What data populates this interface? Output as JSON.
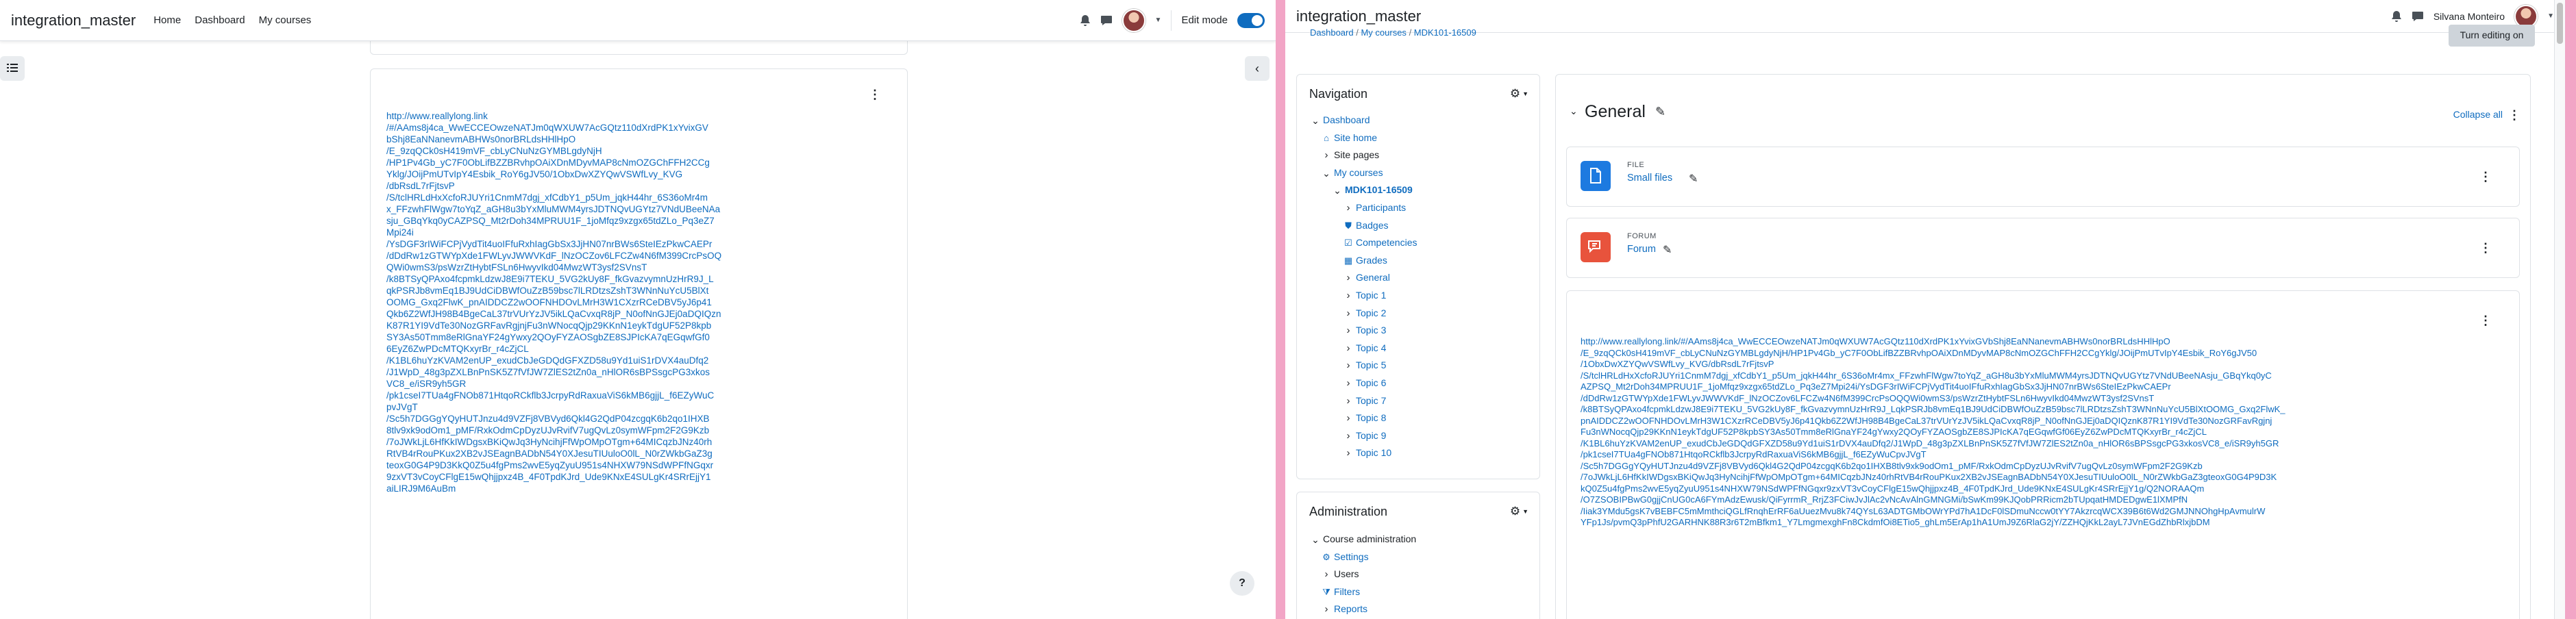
{
  "left": {
    "brand": "integration_master",
    "nav": [
      "Home",
      "Dashboard",
      "My courses"
    ],
    "edit_mode_label": "Edit mode",
    "edit_mode_on": true,
    "url_lines": [
      "http://www.reallylong.link",
      "/#/AAms8j4ca_WwECCEOwzeNATJm0qWXUW7AcGQtz110dXrdPK1xYvixGV",
      "bShj8EaNNanevmABHWs0norBRLdsHHlHpO",
      "/E_9zqQCk0sH419mVF_cbLyCNuNzGYMBLgdyNjH",
      "/HP1Pv4Gb_yC7F0ObLifBZZBRvhpOAiXDnMDyvMAP8cNmOZGChFFH2CCg",
      "Yklg/JOijPmUTvIpY4Esbik_RoY6gJV50/1ObxDwXZYQwVSWfLvy_KVG",
      "/dbRsdL7rFjtsvP",
      "/S/tclHRLdHxXcfoRJUYri1CnmM7dgj_xfCdbY1_p5Um_jqkH44hr_6S36oMr4m",
      "x_FFzwhFlWgw7toYqZ_aGH8u3bYxMluMWM4yrsJDTNQvUGYtz7VNdUBeeNAa",
      "sju_GBqYkq0yCAZPSQ_Mt2rDoh34MPRUU1F_1joMfqz9xzgx65tdZLo_Pq3eZ7",
      "Mpi24i",
      "/YsDGF3rIWiFCPjVydTit4uoIFfuRxhIagGbSx3JjHN07nrBWs6SteIEzPkwCAEPr",
      "/dDdRw1zGTWYpXde1FWLyvJWWVKdF_lNzOCZov6LFCZw4N6fM399CrcPsOQ",
      "QWi0wmS3/psWzrZtHybtFSLn6HwyvIkd04MwzWT3ysf2SVnsT",
      "/k8BTSyQPAxo4fcpmkLdzwJ8E9i7TEKU_5VG2kUy8F_fkGvazvymnUzHrR9J_L",
      "qkPSRJb8vmEq1BJ9UdCiDBWfOuZzB59bsc7lLRDtzsZshT3WNnNuYcU5BlXt",
      "OOMG_Gxq2FlwK_pnAIDDCZ2wOOFNHDOvLMrH3W1CXzrRCeDBV5yJ6p41",
      "Qkb6Z2WfJH98B4BgeCaL37trVUrYzJV5ikLQaCvxqR8jP_N0ofNnGJEj0aDQIQzn",
      "K87R1YI9VdTe30NozGRFavRgjnjFu3nWNocqQjp29KKnN1eykTdgUF52P8kpb",
      "SY3As50Tmm8eRlGnaYF24gYwxy2QOyFYZAOSgbZE8SJPIcKA7qEGqwfGf0",
      "6EyZ6ZwPDcMTQKxyrBr_r4cZjCL",
      "/K1BL6huYzKVAM2enUP_exudCbJeGDQdGFXZD58u9Yd1uiS1rDVX4auDfq2",
      "/J1WpD_48g3pZXLBnPnSK5Z7fVfJW7ZlES2tZn0a_nHlOR6sBPSsgcPG3xkos",
      "VC8_e/iSR9yh5GR",
      "/pk1cseI7TUa4gFNOb871HtqoRCkflb3JcrpyRdRaxuaViS6kMB6gjjL_f6EZyWuC",
      "pvJVgT",
      "/Sc5h7DGGgYQyHUTJnzu4d9VZFj8VBVyd6Qkl4G2QdP04zcgqK6b2qo1IHXB",
      "8tlv9xk9odOm1_pMF/RxkOdmCpDyzUJvRvifV7ugQvLz0symWFpm2F2G9Kzb",
      "/7oJWkLjL6HfKkIWDgsxBKiQwJq3HyNcihjFfWpOMpOTgm+64MICqzbJNz40rh",
      "RtVB4rRouPKux2XB2vJSEagnBADbN54Y0XJesuTIUuloO0lL_N0rZWkbGaZ3g",
      "teoxG0G4P9D3KkQ0Z5u4fgPms2wvE5yqZyuU951s4NHXW79NSdWPFfNGqxr",
      "9zxVT3vCoyCFlgE15wQhjjpxz4B_4F0TpdKJrd_Ude9KNxE4SULgKr4SRrEjjY1",
      "aiLIRJ9M6AuBm"
    ]
  },
  "right": {
    "brand": "integration_master",
    "user_name": "Silvana Monteiro",
    "breadcrumb": [
      "Dashboard",
      "My courses",
      "MDK101-16509"
    ],
    "turn_editing": "Turn editing on",
    "navigation": {
      "title": "Navigation",
      "items": [
        {
          "label": "Dashboard",
          "level": 0,
          "chev": "open",
          "link": true
        },
        {
          "label": "Site home",
          "level": 1,
          "chev": "none",
          "link": true,
          "icon": "house-icon"
        },
        {
          "label": "Site pages",
          "level": 1,
          "chev": "closed",
          "link": false
        },
        {
          "label": "My courses",
          "level": 1,
          "chev": "open",
          "link": true
        },
        {
          "label": "MDK101-16509",
          "level": 2,
          "chev": "open",
          "link": true,
          "bold": true
        },
        {
          "label": "Participants",
          "level": 3,
          "chev": "closed",
          "link": true
        },
        {
          "label": "Badges",
          "level": 3,
          "chev": "none",
          "link": true,
          "icon": "shield-icon"
        },
        {
          "label": "Competencies",
          "level": 3,
          "chev": "none",
          "link": true,
          "icon": "checklist-icon"
        },
        {
          "label": "Grades",
          "level": 3,
          "chev": "none",
          "link": true,
          "icon": "table-icon"
        },
        {
          "label": "General",
          "level": 3,
          "chev": "closed",
          "link": true
        },
        {
          "label": "Topic 1",
          "level": 3,
          "chev": "closed",
          "link": true
        },
        {
          "label": "Topic 2",
          "level": 3,
          "chev": "closed",
          "link": true
        },
        {
          "label": "Topic 3",
          "level": 3,
          "chev": "closed",
          "link": true
        },
        {
          "label": "Topic 4",
          "level": 3,
          "chev": "closed",
          "link": true
        },
        {
          "label": "Topic 5",
          "level": 3,
          "chev": "closed",
          "link": true
        },
        {
          "label": "Topic 6",
          "level": 3,
          "chev": "closed",
          "link": true
        },
        {
          "label": "Topic 7",
          "level": 3,
          "chev": "closed",
          "link": true
        },
        {
          "label": "Topic 8",
          "level": 3,
          "chev": "closed",
          "link": true
        },
        {
          "label": "Topic 9",
          "level": 3,
          "chev": "closed",
          "link": true
        },
        {
          "label": "Topic 10",
          "level": 3,
          "chev": "closed",
          "link": true
        }
      ]
    },
    "administration": {
      "title": "Administration",
      "items": [
        {
          "label": "Course administration",
          "level": 0,
          "chev": "open",
          "link": false
        },
        {
          "label": "Settings",
          "level": 1,
          "chev": "none",
          "link": true,
          "icon": "gear-icon"
        },
        {
          "label": "Users",
          "level": 1,
          "chev": "closed",
          "link": false
        },
        {
          "label": "Filters",
          "level": 1,
          "chev": "none",
          "link": true,
          "icon": "filter-icon"
        },
        {
          "label": "Reports",
          "level": 1,
          "chev": "closed",
          "link": true
        }
      ]
    },
    "section": {
      "title": "General",
      "collapse_all": "Collapse all"
    },
    "modules": [
      {
        "type": "FILE",
        "name": "Small files",
        "color": "#1d7ae0",
        "icon": "file-icon"
      },
      {
        "type": "FORUM",
        "name": "Forum",
        "color": "#e8533c",
        "icon": "forum-icon"
      }
    ],
    "url_lines": [
      "http://www.reallylong.link/#/AAms8j4ca_WwECCEOwzeNATJm0qWXUW7AcGQtz110dXrdPK1xYvixGVbShj8EaNNanevmABHWs0norBRLdsHHlHpO",
      "/E_9zqQCk0sH419mVF_cbLyCNuNzGYMBLgdyNjH/HP1Pv4Gb_yC7F0ObLifBZZBRvhpOAiXDnMDyvMAP8cNmOZGChFFH2CCgYklg/JOijPmUTvIpY4Esbik_RoY6gJV50",
      "/1ObxDwXZYQwVSWfLvy_KVG/dbRsdL7rFjtsvP",
      "/S/tclHRLdHxXcfoRJUYri1CnmM7dgj_xfCdbY1_p5Um_jqkH44hr_6S36oMr4mx_FFzwhFlWgw7toYqZ_aGH8u3bYxMluMWM4yrsJDTNQvUGYtz7VNdUBeeNAsju_GBqYkq0yC",
      "AZPSQ_Mt2rDoh34MPRUU1F_1joMfqz9xzgx65tdZLo_Pq3eZ7Mpi24i/YsDGF3rIWiFCPjVydTit4uoIFfuRxhIagGbSx3JjHN07nrBWs6SteIEzPkwCAEPr",
      "/dDdRw1zGTWYpXde1FWLyvJWWVKdF_lNzOCZov6LFCZw4N6fM399CrcPsOQQWi0wmS3/psWzrZtHybtFSLn6HwyvIkd04MwzWT3ysf2SVnsT",
      "/k8BTSyQPAxo4fcpmkLdzwJ8E9i7TEKU_5VG2kUy8F_fkGvazvymnUzHrR9J_LqkPSRJb8vmEq1BJ9UdCiDBWfOuZzB59bsc7lLRDtzsZshT3WNnNuYcU5BlXtOOMG_Gxq2FlwK_",
      "pnAIDDCZ2wOOFNHDOvLMrH3W1CXzrRCeDBV5yJ6p41Qkb6Z2WfJH98B4BgeCaL37trVUrYzJV5ikLQaCvxqR8jP_N0ofNnGJEj0aDQIQznK87R1YI9VdTe30NozGRFavRgjnj",
      "Fu3nWNocqQjp29KKnN1eykTdgUF52P8kpbSY3As50Tmm8eRlGnaYF24gYwxy2QOyFYZAOSgbZE8SJPIcKA7qEGqwfGf06EyZ6ZwPDcMTQKxyrBr_r4cZjCL",
      "/K1BL6huYzKVAM2enUP_exudCbJeGDQdGFXZD58u9Yd1uiS1rDVX4auDfq2/J1WpD_48g3pZXLBnPnSK5Z7fVfJW7ZlES2tZn0a_nHlOR6sBPSsgcPG3xkosVC8_e/iSR9yh5GR",
      "/pk1cseI7TUa4gFNOb871HtqoRCkflb3JcrpyRdRaxuaViS6kMB6gjjL_f6EZyWuCpvJVgT",
      "/Sc5h7DGGgYQyHUTJnzu4d9VZFj8VBVyd6Qkl4G2QdP04zcgqK6b2qo1IHXB8tlv9xk9odOm1_pMF/RxkOdmCpDyzUJvRvifV7ugQvLz0symWFpm2F2G9Kzb",
      "/7oJWkLjL6HfKkIWDgsxBKiQwJq3HyNcihjFfWpOMpOTgm+64MICqzbJNz40rhRtVB4rRouPKux2XB2vJSEagnBADbN54Y0XJesuTIUuloO0lL_N0rZWkbGaZ3gteoxG0G4P9D3K",
      "kQ0Z5u4fgPms2wvE5yqZyuU951s4NHXW79NSdWPFfNGqxr9zxVT3vCoyCFlgE15wQhjjpxz4B_4F0TpdKJrd_Ude9KNxE4SULgKr4SRrEjjY1g/Q2NORAAQm",
      "/O7ZSOBIPBwG0gjjCnUG0cA6FYmAdzEwusk/QiFyrrmR_RrjZ3FCiwJvJlAc2vNcAvAlnGMNGMi/bSwKm99KJQobPRRicm2bTUpqatHMDEDgwE1lXMPfN",
      "/Iiak3YMdu5gsK7vBEBFC5mMmthciQGLfRnqhErRF6aUuezMvu8k74QYsL63ADTGMbOWrYPd7hA1DcF0lSDmuNccw0tYY7AkzrcqWCX39B6t6Wd2GMJNNOhgHpAvmulrW",
      "YFp1Js/pvmQ3pPhfU2GARHNK88R3r6T2mBfkm1_Y7LmgmexghFn8CkdmfOi8ETio5_ghLm5ErAp1hA1UmJ9Z6RlaG2jY/ZZHQjKkL2ayL7JVnEGdZhbRlxjbDM"
    ]
  }
}
